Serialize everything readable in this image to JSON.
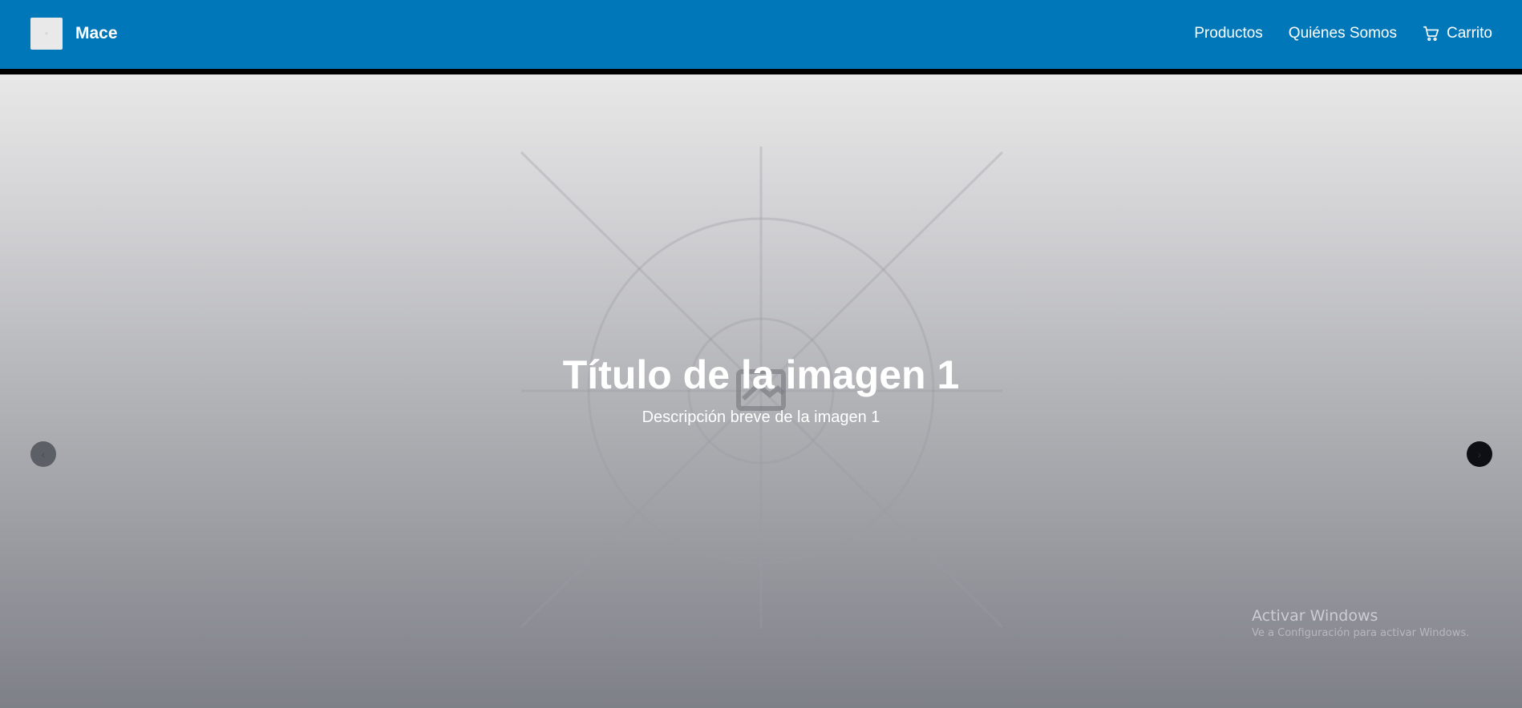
{
  "header": {
    "brand": "Mace",
    "nav": {
      "products": "Productos",
      "about": "Quiénes Somos",
      "cart": "Carrito"
    },
    "colors": {
      "background": "#0077b9",
      "border": "#000000",
      "text": "#ffffff"
    }
  },
  "carousel": {
    "title": "Título de la imagen 1",
    "description": "Descripción breve de la imagen 1",
    "prev_icon": "chevron-left-icon",
    "next_icon": "chevron-right-icon"
  },
  "watermark": {
    "title": "Activar Windows",
    "subtitle": "Ve a Configuración para activar Windows."
  }
}
